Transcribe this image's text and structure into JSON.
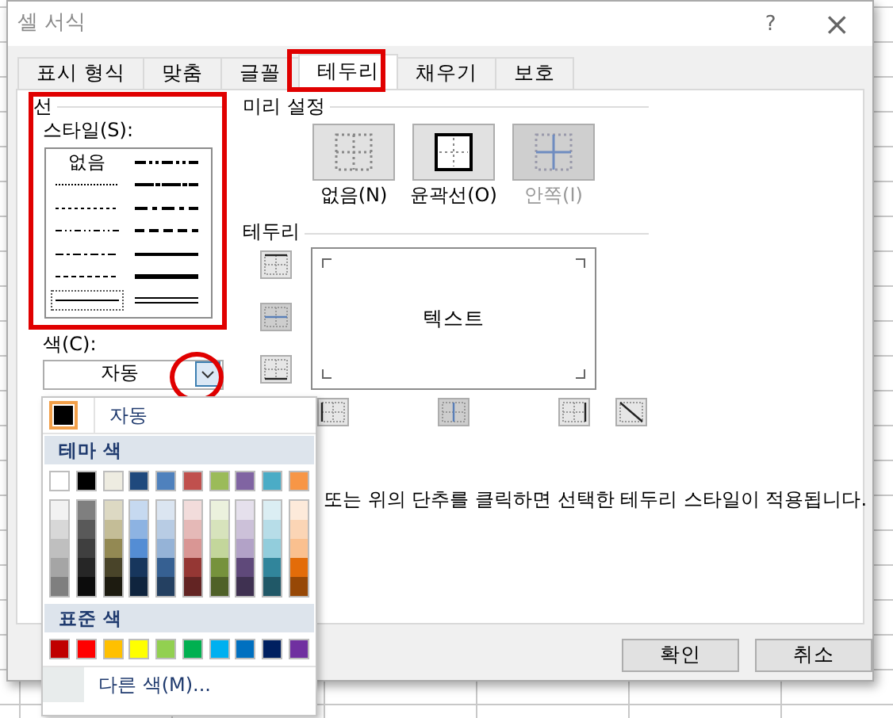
{
  "window": {
    "title": "셀 서식",
    "help": "?",
    "close": "×"
  },
  "tabs": [
    {
      "label": "표시 형식",
      "selected": false
    },
    {
      "label": "맞춤",
      "selected": false
    },
    {
      "label": "글꼴",
      "selected": false
    },
    {
      "label": "테두리",
      "selected": true
    },
    {
      "label": "채우기",
      "selected": false
    },
    {
      "label": "보호",
      "selected": false
    }
  ],
  "line": {
    "group_label": "선",
    "style_label": "스타일(S):",
    "color_label": "색(C):",
    "color_value": "자동",
    "styles": [
      {
        "kind": "none",
        "label": "없음",
        "selected": false
      },
      {
        "kind": "hair",
        "selected": false
      },
      {
        "kind": "dotted",
        "selected": false
      },
      {
        "kind": "dashdotdot",
        "selected": false
      },
      {
        "kind": "dashdot",
        "selected": false
      },
      {
        "kind": "dashed",
        "selected": false
      },
      {
        "kind": "thin",
        "selected": true
      },
      {
        "kind": "mdashdotdot",
        "selected": false
      },
      {
        "kind": "slant",
        "selected": false
      },
      {
        "kind": "mdashdot",
        "selected": false
      },
      {
        "kind": "mdashed",
        "selected": false
      },
      {
        "kind": "medium",
        "selected": false
      },
      {
        "kind": "thick",
        "selected": false
      },
      {
        "kind": "double",
        "selected": false
      }
    ]
  },
  "presets": {
    "label": "미리 설정",
    "items": [
      {
        "kind": "none",
        "label": "없음(N)",
        "disabled": false
      },
      {
        "kind": "outline",
        "label": "윤곽선(O)",
        "disabled": false
      },
      {
        "kind": "inside",
        "label": "안쪽(I)",
        "disabled": true
      }
    ]
  },
  "border": {
    "label": "테두리",
    "preview_text": "텍스트",
    "side_buttons": [
      {
        "kind": "top",
        "disabled": false
      },
      {
        "kind": "horizontal",
        "disabled": true
      },
      {
        "kind": "bottom",
        "disabled": false
      }
    ],
    "bottom_buttons": [
      {
        "kind": "left",
        "disabled": false
      },
      {
        "kind": "vertical",
        "disabled": true
      },
      {
        "kind": "right",
        "disabled": false
      }
    ],
    "diagonal_button": {
      "kind": "diagonal",
      "disabled": false
    }
  },
  "hint": "또는 위의 단추를 클릭하면 선택한 테두리 스타일이 적용됩니다.",
  "buttons": [
    {
      "label": "확인"
    },
    {
      "label": "취소"
    }
  ],
  "color_menu": {
    "auto": {
      "label": "자동",
      "color": "#000000"
    },
    "theme_label": "테마 색",
    "theme": [
      {
        "color": "#ffffff",
        "shades": [
          {
            "color": "#f2f2f2"
          },
          {
            "color": "#d8d8d8"
          },
          {
            "color": "#bfbfbf"
          },
          {
            "color": "#a5a5a5"
          },
          {
            "color": "#7f7f7f"
          }
        ]
      },
      {
        "color": "#000000",
        "shades": [
          {
            "color": "#7f7f7f"
          },
          {
            "color": "#595959"
          },
          {
            "color": "#3f3f3f"
          },
          {
            "color": "#262626"
          },
          {
            "color": "#0c0c0c"
          }
        ]
      },
      {
        "color": "#eeece1",
        "shades": [
          {
            "color": "#ddd9c3"
          },
          {
            "color": "#c4bd97"
          },
          {
            "color": "#938953"
          },
          {
            "color": "#494429"
          },
          {
            "color": "#1d1b10"
          }
        ]
      },
      {
        "color": "#1f497d",
        "shades": [
          {
            "color": "#c6d9f0"
          },
          {
            "color": "#8db3e2"
          },
          {
            "color": "#548dd4"
          },
          {
            "color": "#17365d"
          },
          {
            "color": "#0f243e"
          }
        ]
      },
      {
        "color": "#4f81bd",
        "shades": [
          {
            "color": "#dbe5f1"
          },
          {
            "color": "#b8cce4"
          },
          {
            "color": "#95b3d7"
          },
          {
            "color": "#366092"
          },
          {
            "color": "#244061"
          }
        ]
      },
      {
        "color": "#c0504d",
        "shades": [
          {
            "color": "#f2dcdb"
          },
          {
            "color": "#e5b9b7"
          },
          {
            "color": "#d99694"
          },
          {
            "color": "#953734"
          },
          {
            "color": "#632423"
          }
        ]
      },
      {
        "color": "#9bbb59",
        "shades": [
          {
            "color": "#ebf1dd"
          },
          {
            "color": "#d7e3bc"
          },
          {
            "color": "#c3d69b"
          },
          {
            "color": "#76923c"
          },
          {
            "color": "#4f6128"
          }
        ]
      },
      {
        "color": "#8064a2",
        "shades": [
          {
            "color": "#e5e0ec"
          },
          {
            "color": "#ccc1d9"
          },
          {
            "color": "#b2a2c7"
          },
          {
            "color": "#5f497a"
          },
          {
            "color": "#3f3151"
          }
        ]
      },
      {
        "color": "#4bacc6",
        "shades": [
          {
            "color": "#dbeef3"
          },
          {
            "color": "#b7dde8"
          },
          {
            "color": "#92cddc"
          },
          {
            "color": "#31859b"
          },
          {
            "color": "#205867"
          }
        ]
      },
      {
        "color": "#f79646",
        "shades": [
          {
            "color": "#fdeada"
          },
          {
            "color": "#fbd5b5"
          },
          {
            "color": "#fac08f"
          },
          {
            "color": "#e36c09"
          },
          {
            "color": "#974806"
          }
        ]
      }
    ],
    "standard_label": "표준 색",
    "standard": [
      {
        "color": "#c00000"
      },
      {
        "color": "#ff0000"
      },
      {
        "color": "#ffc000"
      },
      {
        "color": "#ffff00"
      },
      {
        "color": "#92d050"
      },
      {
        "color": "#00b050"
      },
      {
        "color": "#00b0f0"
      },
      {
        "color": "#0070c0"
      },
      {
        "color": "#002060"
      },
      {
        "color": "#7030a0"
      }
    ],
    "more_label": "다른 색(M)..."
  }
}
